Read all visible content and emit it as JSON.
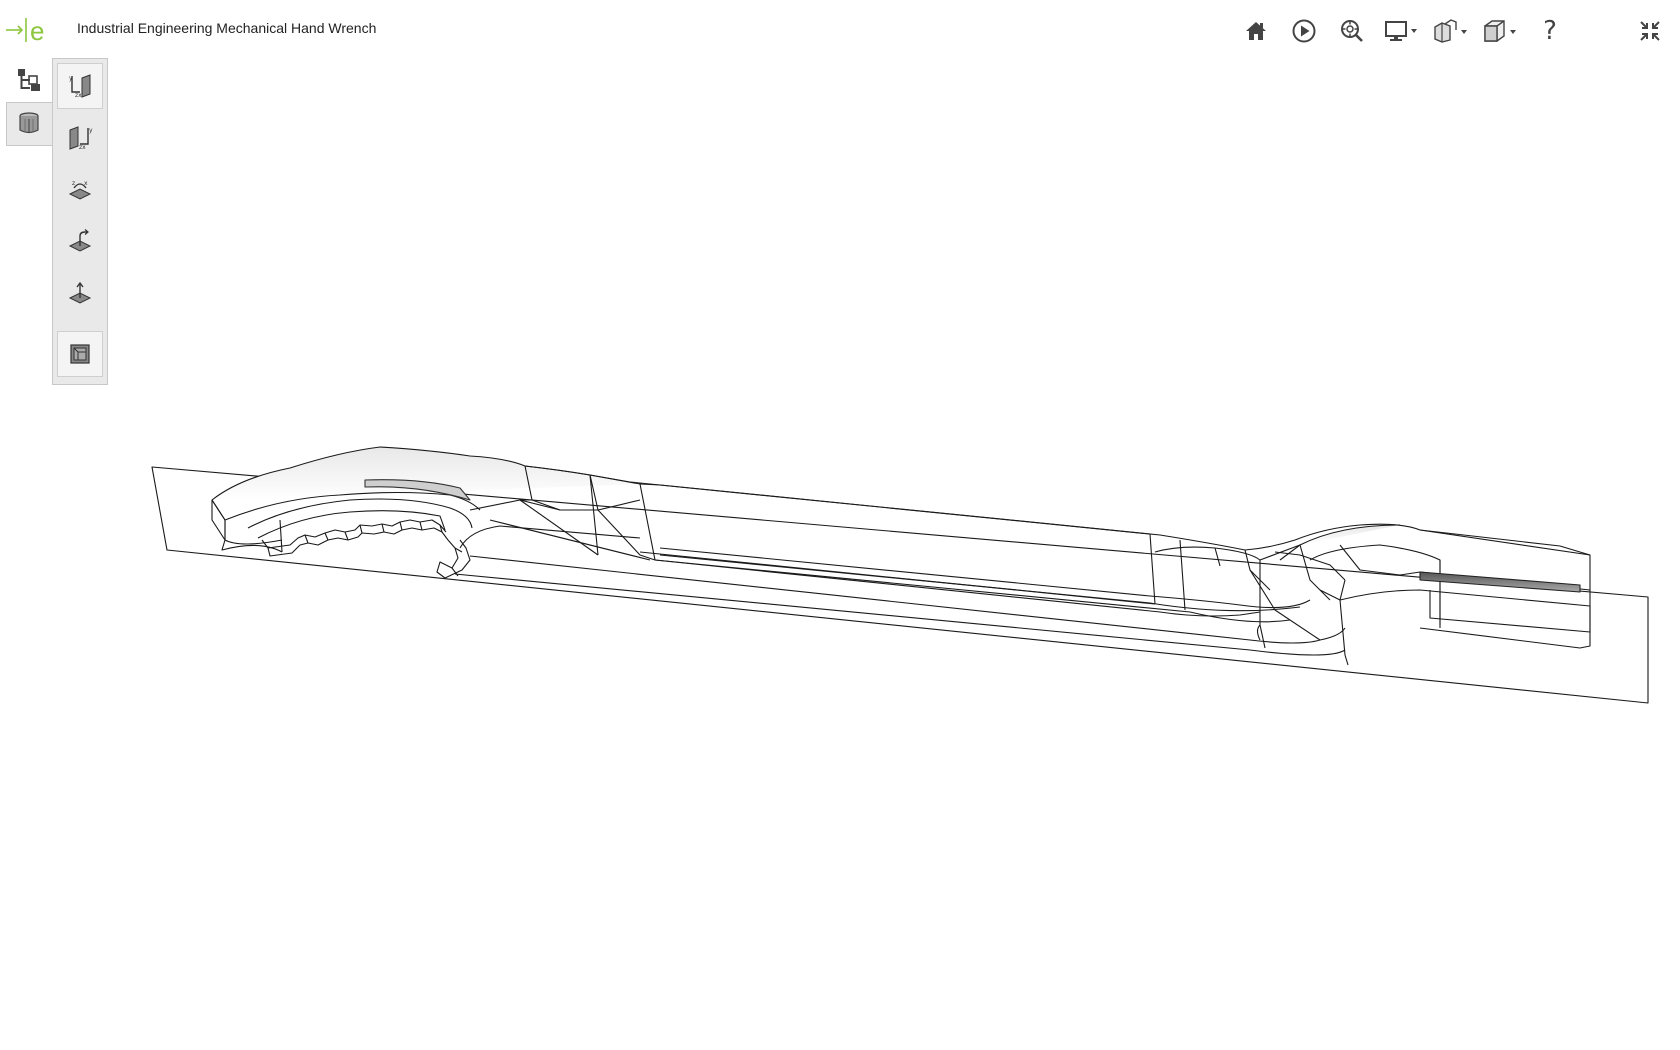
{
  "header": {
    "title": "Industrial Engineering Mechanical Hand Wrench",
    "logo_letter": "e",
    "accent_color": "#8dc63f"
  },
  "toolbar": {
    "items": [
      {
        "icon": "home-icon"
      },
      {
        "icon": "play-icon"
      },
      {
        "icon": "zoom-fit-icon"
      },
      {
        "icon": "display-mode-icon",
        "dropdown": true
      },
      {
        "icon": "explode-view-icon",
        "dropdown": true
      },
      {
        "icon": "view-cube-icon",
        "dropdown": true
      },
      {
        "icon": "help-icon",
        "glyph": "?"
      },
      {
        "icon": "fullscreen-exit-icon"
      }
    ]
  },
  "side_tabs": [
    {
      "icon": "assembly-tree-icon",
      "active": false
    },
    {
      "icon": "section-views-icon",
      "active": true
    }
  ],
  "section_tools": [
    {
      "icon": "section-plane-yz-icon",
      "boxed": true
    },
    {
      "icon": "section-plane-zy-icon",
      "boxed": false
    },
    {
      "icon": "section-plane-xz-icon",
      "boxed": false
    },
    {
      "icon": "section-rotate-icon",
      "boxed": false
    },
    {
      "icon": "section-move-icon",
      "boxed": false
    },
    {
      "icon": "section-cap-icon",
      "boxed": true
    }
  ],
  "model": {
    "render_style": "wireframe-with-hidden-edges",
    "stroke_color": "#1a1a1a"
  }
}
